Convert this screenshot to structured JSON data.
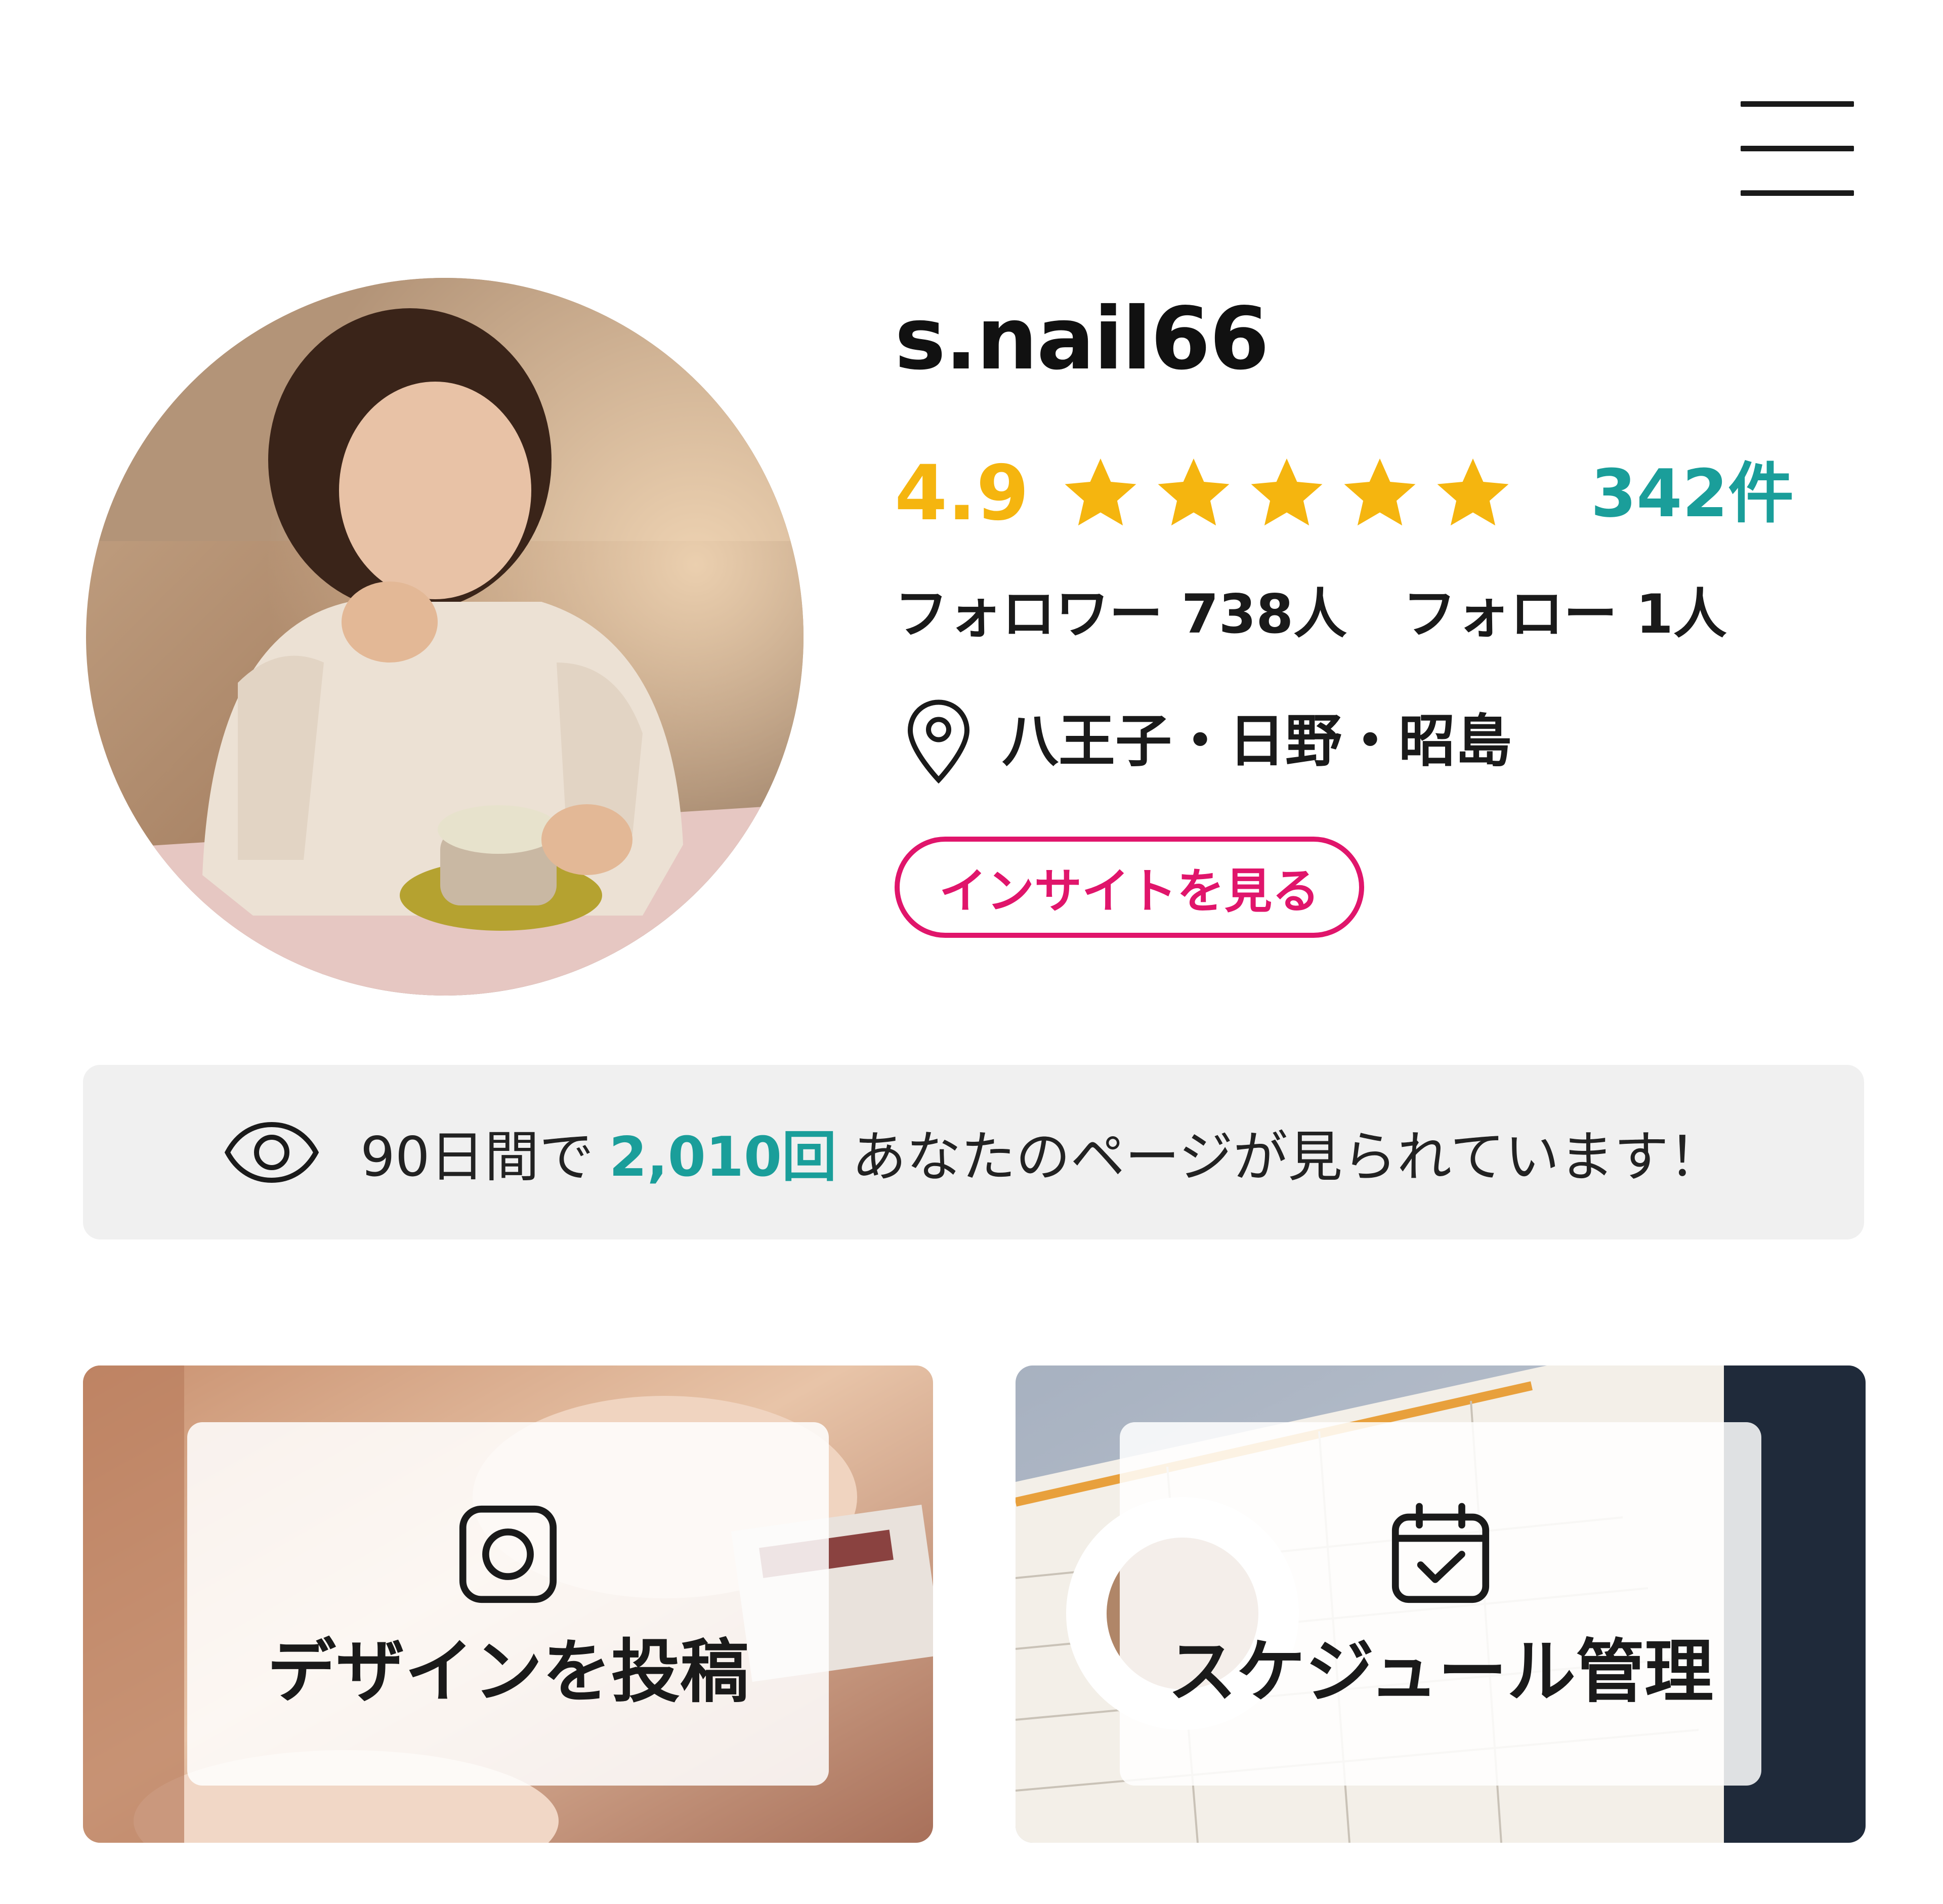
{
  "header": {
    "menu_icon": "hamburger-menu-icon"
  },
  "profile": {
    "username": "s.nail66",
    "rating": "4.9",
    "rating_stars": 5,
    "review_count": "342件",
    "followers": "フォロワー 738人",
    "following": "フォロー 1人",
    "location": "八王子・日野・昭島",
    "insight_button": "インサイトを見る"
  },
  "views_banner": {
    "prefix": "90日間で",
    "count": "2,010回",
    "suffix": "あなたのページが見られています！"
  },
  "actions": {
    "post_design": "デザインを投稿",
    "schedule": "スケジュール管理"
  },
  "colors": {
    "rating": "#f5b50f",
    "accent_teal": "#1a9e9a",
    "insight_pink": "#e0156b",
    "banner_bg": "#f0f0f0"
  }
}
